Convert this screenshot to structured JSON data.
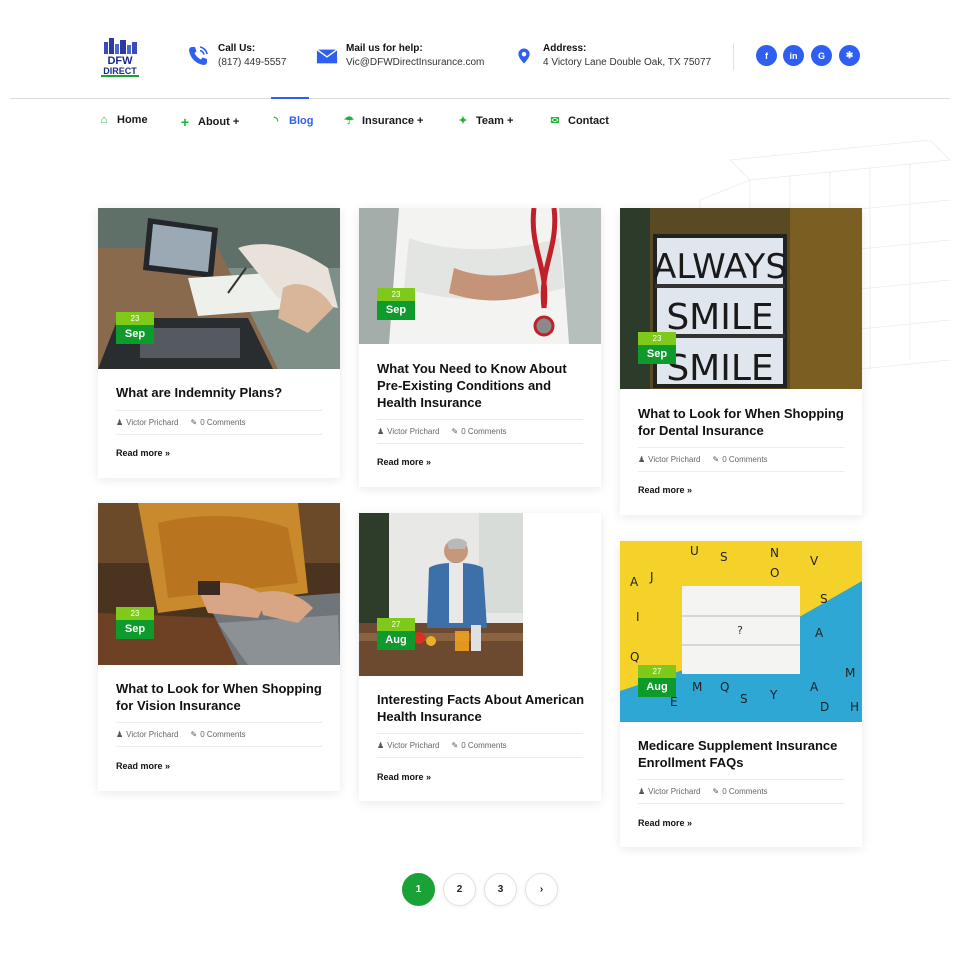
{
  "header": {
    "logo_text": "DFW DIRECT",
    "call": {
      "label": "Call Us:",
      "value": "(817) 449-5557",
      "icon": "phone-icon"
    },
    "mail": {
      "label": "Mail us for help:",
      "value": "Vic@DFWDirectInsurance.com",
      "icon": "mail-icon"
    },
    "address": {
      "label": "Address:",
      "value": "4 Victory Lane Double Oak, TX 75077",
      "icon": "location-pin-icon"
    },
    "social": [
      {
        "name": "facebook-icon",
        "glyph": "f"
      },
      {
        "name": "linkedin-icon",
        "glyph": "in"
      },
      {
        "name": "google-icon",
        "glyph": "G"
      },
      {
        "name": "yelp-icon",
        "glyph": "✱"
      }
    ]
  },
  "nav": [
    {
      "label": "Home",
      "icon": "home-icon",
      "glyph": "⌂"
    },
    {
      "label": "About +",
      "icon": "plus-icon",
      "glyph": "+"
    },
    {
      "label": "Blog",
      "icon": "rss-icon",
      "glyph": "◝",
      "active": true
    },
    {
      "label": "Insurance +",
      "icon": "umbrella-icon",
      "glyph": "☂"
    },
    {
      "label": "Team +",
      "icon": "users-icon",
      "glyph": "✦"
    },
    {
      "label": "Contact",
      "icon": "envelope-icon",
      "glyph": "✉"
    }
  ],
  "posts": [
    {
      "day": "23",
      "month": "Sep",
      "title": "What are Indemnity Plans?",
      "author": "Victor Prichard",
      "comments": "0 Comments",
      "read_more": "Read more »",
      "image": "laptop-desk-photo"
    },
    {
      "day": "23",
      "month": "Sep",
      "title": "What You Need to Know About Pre-Existing Conditions and Health Insurance",
      "author": "Victor Prichard",
      "comments": "0 Comments",
      "read_more": "Read more »",
      "image": "doctor-stethoscope-photo"
    },
    {
      "day": "23",
      "month": "Sep",
      "title": "What to Look for When Shopping for Dental Insurance",
      "author": "Victor Prichard",
      "comments": "0 Comments",
      "read_more": "Read more »",
      "image": "always-smile-lightbox-photo",
      "image_text": [
        "ALWAYS",
        "SMILE",
        "SMILE"
      ]
    },
    {
      "day": "23",
      "month": "Sep",
      "title": "What to Look for When Shopping for Vision Insurance",
      "author": "Victor Prichard",
      "comments": "0 Comments",
      "read_more": "Read more »",
      "image": "typing-laptop-photo"
    },
    {
      "day": "27",
      "month": "Aug",
      "title": "Interesting Facts About American Health Insurance",
      "author": "Victor Prichard",
      "comments": "0 Comments",
      "read_more": "Read more »",
      "image": "man-kitchen-photo"
    },
    {
      "day": "27",
      "month": "Aug",
      "title": "Medicare Supplement Insurance Enrollment FAQs",
      "author": "Victor Prichard",
      "comments": "0 Comments",
      "read_more": "Read more »",
      "image": "question-lightbox-letters-photo",
      "image_text": "?"
    }
  ],
  "pagination": {
    "pages": [
      "1",
      "2",
      "3"
    ],
    "current": "1",
    "next": "›"
  },
  "colors": {
    "brand_blue": "#2f5ff0",
    "brand_green": "#1aa236",
    "date_light": "#7fc91a",
    "date_dark": "#0f9a2c"
  }
}
